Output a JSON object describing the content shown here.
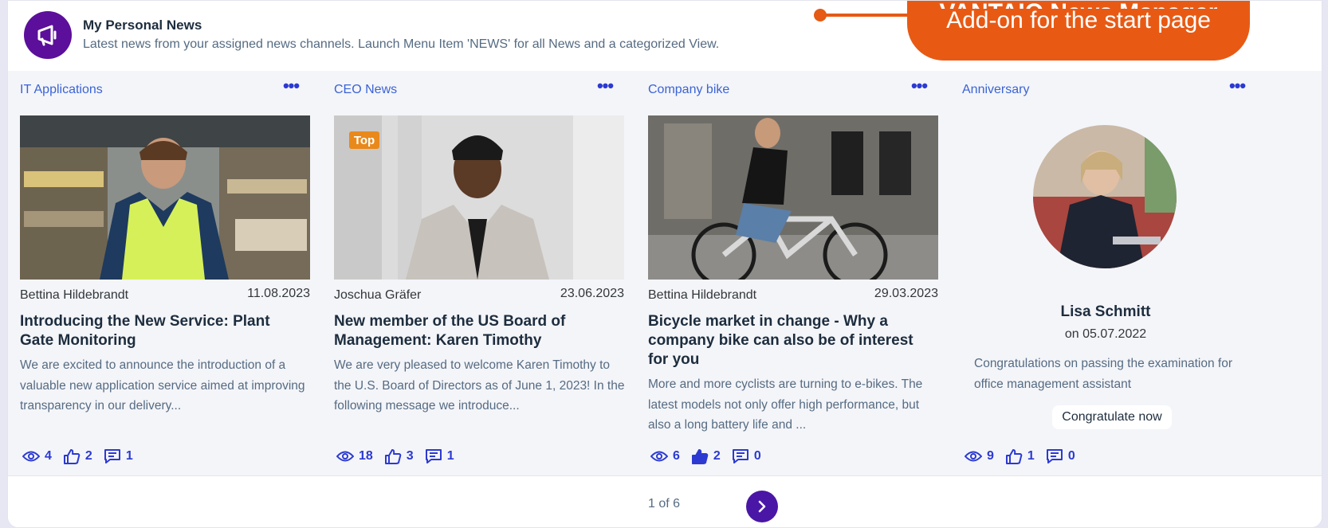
{
  "header": {
    "title": "My Personal News",
    "subtitle": "Latest news from your assigned news channels. Launch Menu Item 'NEWS' for all News and a categorized View."
  },
  "callout": {
    "line1": "VANTAIO News Manager",
    "line2": "Add-on for the start page"
  },
  "news": [
    {
      "category": "IT Applications",
      "author": "Bettina Hildebrandt",
      "date": "11.08.2023",
      "title": "Introducing the New Service: Plant Gate Monitoring",
      "excerpt": "We are excited to announce the introduction of a valuable new application service aimed at improving transparency in our delivery...",
      "views": "4",
      "likes": "2",
      "comments": "1"
    },
    {
      "category": "CEO News",
      "badge": "Top",
      "author": "Joschua Gräfer",
      "date": "23.06.2023",
      "title": "New member of the US Board of Management: Karen Timothy",
      "excerpt": "We are very pleased to welcome Karen Timothy to the U.S. Board of Directors as of June 1, 2023! In the following message we introduce...",
      "views": "18",
      "likes": "3",
      "comments": "1"
    },
    {
      "category": "Company bike",
      "author": "Bettina Hildebrandt",
      "date": "29.03.2023",
      "title": "Bicycle market in change - Why a company bike can also be of interest for you",
      "excerpt": "More and more cyclists are turning to e-bikes. The latest models not only offer high performance, but also a long battery life and ...",
      "views": "6",
      "likes": "2",
      "comments": "0"
    }
  ],
  "anniversary": {
    "category": "Anniversary",
    "name": "Lisa Schmitt",
    "date": "on 05.07.2022",
    "text": "Congratulations on passing the examination for office management assistant",
    "button": "Congratulate now",
    "views": "9",
    "likes": "1",
    "comments": "0"
  },
  "more_label": "•••",
  "footer": {
    "page_text": "1 of 6"
  },
  "colors": {
    "accent": "#2c3ad1",
    "brand": "#5b0f9a",
    "callout": "#e85a14"
  },
  "icons": {
    "logo": "megaphone-icon",
    "views": "eye-icon",
    "likes": "thumbs-up-icon",
    "comments": "comment-icon",
    "more": "more-icon",
    "next": "chevron-right-icon"
  }
}
